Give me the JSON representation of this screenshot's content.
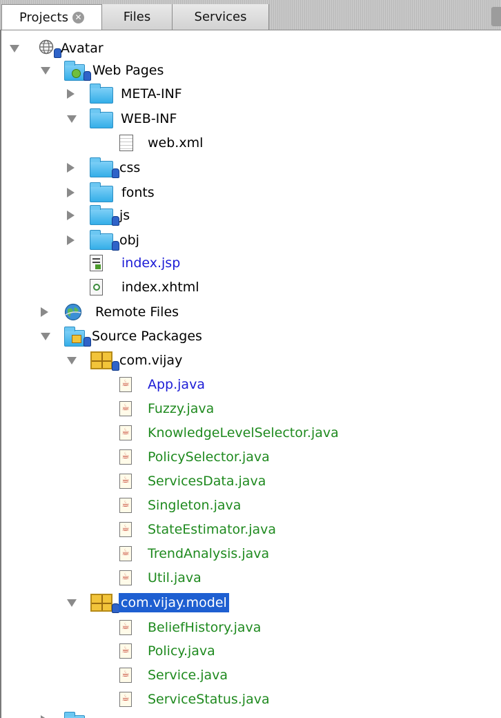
{
  "tabs": [
    {
      "label": "Projects",
      "active": true,
      "closable": true
    },
    {
      "label": "Files",
      "active": false
    },
    {
      "label": "Services",
      "active": false
    }
  ],
  "tree": {
    "root": {
      "label": "Avatar",
      "icon": "globe-project-icon"
    },
    "web_pages": {
      "label": "Web Pages",
      "icon": "web-folder-icon"
    },
    "meta_inf": {
      "label": "META-INF",
      "icon": "folder-icon"
    },
    "web_inf": {
      "label": "WEB-INF",
      "icon": "folder-icon"
    },
    "web_xml": {
      "label": "web.xml",
      "icon": "xml-file-icon"
    },
    "css": {
      "label": "css",
      "icon": "folder-icon"
    },
    "fonts": {
      "label": "fonts",
      "icon": "folder-icon"
    },
    "js": {
      "label": "js",
      "icon": "folder-icon"
    },
    "obj": {
      "label": "obj",
      "icon": "folder-icon"
    },
    "index_jsp": {
      "label": "index.jsp",
      "icon": "jsp-file-icon"
    },
    "index_xhtml": {
      "label": "index.xhtml",
      "icon": "xhtml-file-icon"
    },
    "remote_files": {
      "label": "Remote Files",
      "icon": "remote-globe-icon"
    },
    "source_packages": {
      "label": "Source Packages",
      "icon": "source-packages-icon"
    },
    "pkg_vijay": {
      "label": "com.vijay",
      "icon": "package-icon"
    },
    "vijay_files": [
      "App.java",
      "Fuzzy.java",
      "KnowledgeLevelSelector.java",
      "PolicySelector.java",
      "ServicesData.java",
      "Singleton.java",
      "StateEstimator.java",
      "TrendAnalysis.java",
      "Util.java"
    ],
    "pkg_model": {
      "label": "com.vijay.model",
      "selected": true,
      "icon": "package-icon"
    },
    "model_files": [
      "BeliefHistory.java",
      "Policy.java",
      "Service.java",
      "ServiceStatus.java"
    ]
  },
  "colors": {
    "modified_file": "#1c1cd6",
    "new_file": "#1f8a1f",
    "selection": "#1e5fd1"
  }
}
